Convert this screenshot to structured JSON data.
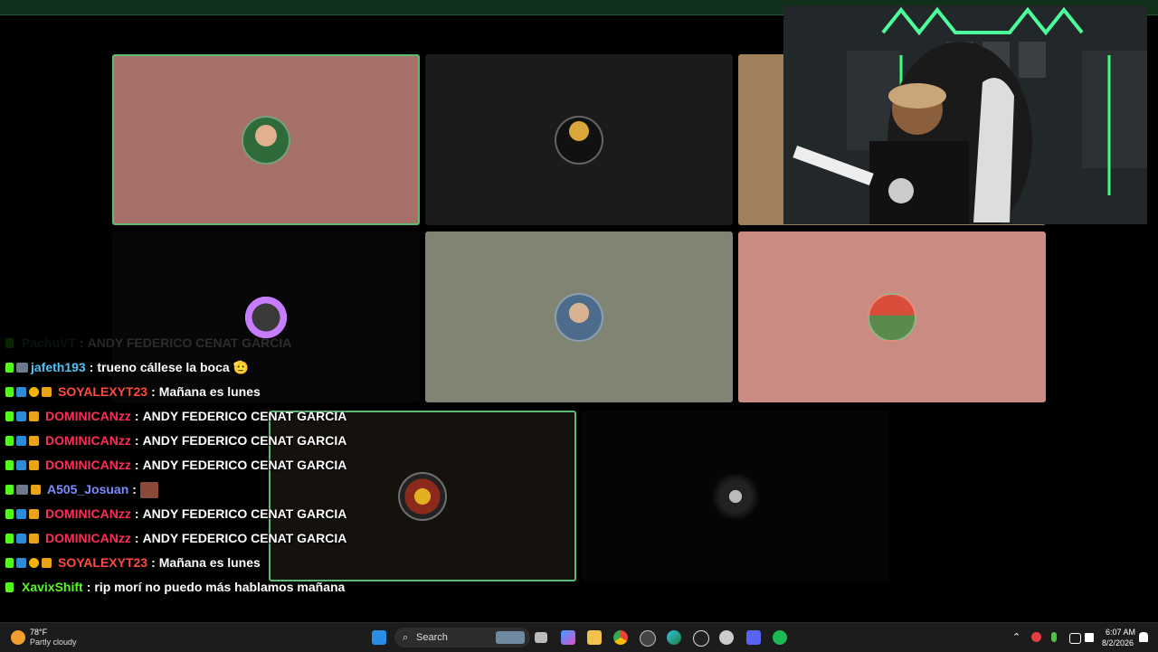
{
  "chat": {
    "messages": [
      {
        "user": "PachuVT",
        "color": "#2e8b57",
        "text": "ANDY FEDERICO CENAT GARCIA",
        "faded": true
      },
      {
        "user": "jafeth193",
        "color": "#4fc3f7",
        "text": "trueno cállese la boca 🫡"
      },
      {
        "user": "SOYALEXYT23",
        "color": "#ff4b3e",
        "text": "Mañana es lunes"
      },
      {
        "user": "DOMINICANzz",
        "color": "#ff2d55",
        "text": "ANDY FEDERICO CENAT GARCIA"
      },
      {
        "user": "DOMINICANzz",
        "color": "#ff2d55",
        "text": "ANDY FEDERICO CENAT GARCIA"
      },
      {
        "user": "DOMINICANzz",
        "color": "#ff2d55",
        "text": "ANDY FEDERICO CENAT GARCIA"
      },
      {
        "user": "A505_Josuan",
        "color": "#7b8cff",
        "text": ""
      },
      {
        "user": "DOMINICANzz",
        "color": "#ff2d55",
        "text": "ANDY FEDERICO CENAT GARCIA"
      },
      {
        "user": "DOMINICANzz",
        "color": "#ff2d55",
        "text": "ANDY FEDERICO CENAT GARCIA"
      },
      {
        "user": "SOYALEXYT23",
        "color": "#ff4b3e",
        "text": "Mañana es lunes"
      },
      {
        "user": "XavixShift",
        "color": "#53fc18",
        "text": "rip morí no puedo más hablamos mañana"
      }
    ]
  },
  "taskbar": {
    "weather_temp": "78°F",
    "weather_desc": "Partly cloudy",
    "search_placeholder": "Search",
    "time": "6:07 AM",
    "date": "8/2/2026"
  },
  "colors": {
    "kick_green": "#53fc18",
    "active_border": "#5dbb73"
  }
}
